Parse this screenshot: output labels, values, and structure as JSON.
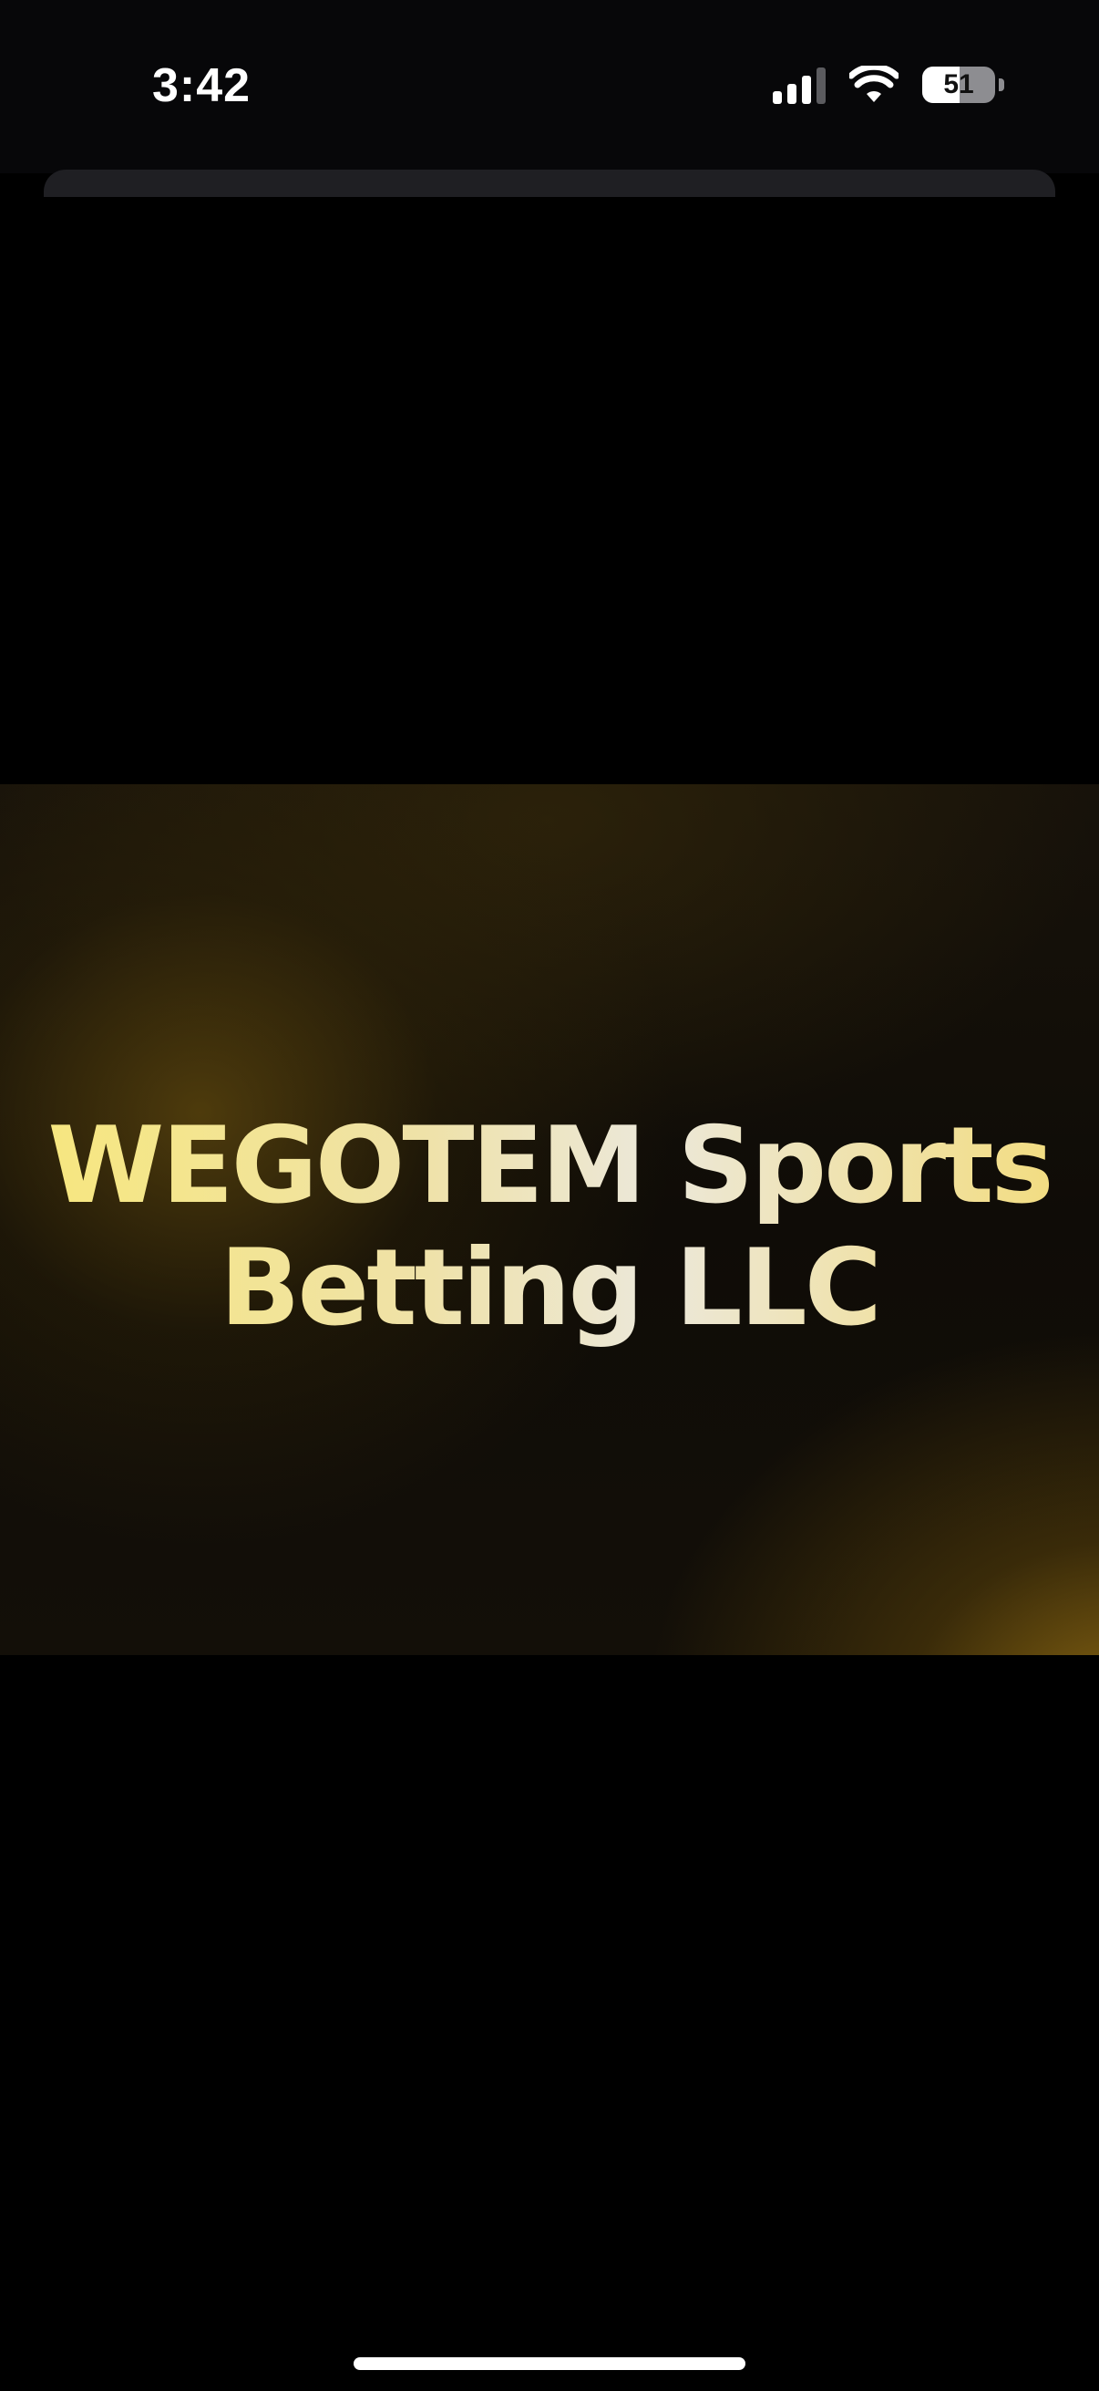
{
  "status_bar": {
    "time": "3:42",
    "battery_level": 51,
    "battery_label": "51",
    "signal_bars": 3,
    "signal_bars_total": 4
  },
  "banner": {
    "title": "WEGOTEM Sports Betting LLC",
    "accent_gold": "#f7e77d",
    "background": "#0f0c07"
  },
  "icons": {
    "signal": "cellular-signal-icon",
    "wifi": "wifi-icon",
    "battery": "battery-icon"
  }
}
